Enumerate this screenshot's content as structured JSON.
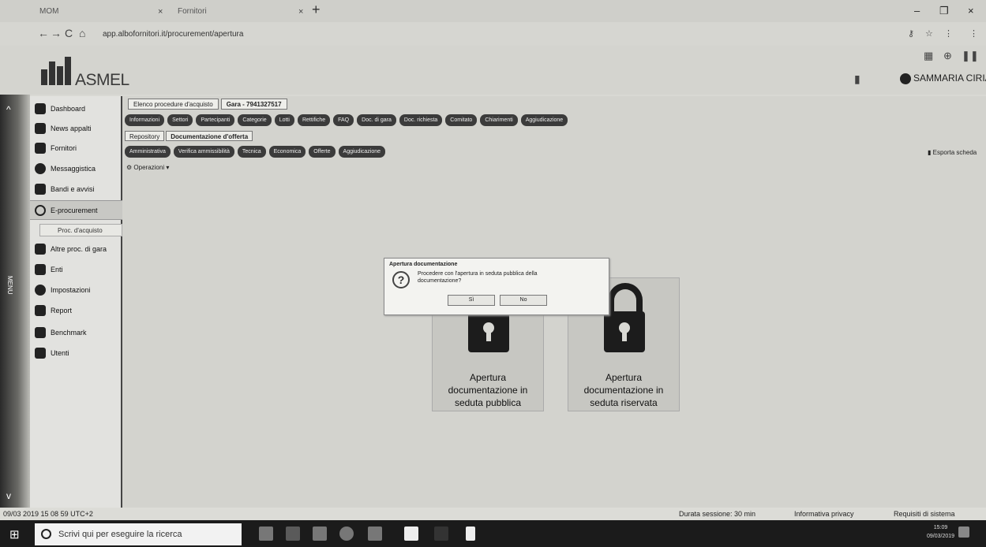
{
  "browser": {
    "tab1_label": "MOM",
    "tab2_label": "Fornitori",
    "url": "app.albofornitori.it/procurement/apertura",
    "close_glyph": "×",
    "new_tab_glyph": "+",
    "minimize_glyph": "–",
    "maximize_glyph": "❐",
    "window_close_glyph": "×",
    "back_glyph": "←",
    "forward_glyph": "→",
    "reload_glyph": "C",
    "home_glyph": "⌂"
  },
  "header": {
    "logo_text": "ASMEL",
    "user_name": "SAMMARIA CIRIANO"
  },
  "sidebar": {
    "items": [
      {
        "label": "Dashboard",
        "icon": "home-icon"
      },
      {
        "label": "News appalti",
        "icon": "news-icon"
      },
      {
        "label": "Fornitori",
        "icon": "truck-icon"
      },
      {
        "label": "Messaggistica",
        "icon": "message-icon"
      },
      {
        "label": "Bandi e avvisi",
        "icon": "megaphone-icon"
      },
      {
        "label": "E-procurement",
        "icon": "procurement-icon"
      },
      {
        "label": "Altre proc. di gara",
        "icon": "folder-icon"
      },
      {
        "label": "Enti",
        "icon": "users-icon"
      },
      {
        "label": "Impostazioni",
        "icon": "gear-icon"
      },
      {
        "label": "Report",
        "icon": "report-icon"
      },
      {
        "label": "Benchmark",
        "icon": "benchmark-icon"
      },
      {
        "label": "Utenti",
        "icon": "user-icon"
      }
    ],
    "submenu_label": "Proc. d'acquisto",
    "side_label": "MENU"
  },
  "main": {
    "breadcrumbs": [
      "Elenco procedure d'acquisto",
      "Gara - 7941327517"
    ],
    "chips_row1": [
      "Informazioni",
      "Settori",
      "Partecipanti",
      "Categorie",
      "Lotti",
      "Rettifiche",
      "FAQ",
      "Doc. di gara",
      "Doc. richiesta",
      "Comitato",
      "Chiarimenti",
      "Aggiudicazione"
    ],
    "subtabs": [
      "Repository",
      "Documentazione d'offerta"
    ],
    "chips_row2": [
      "Amministrativa",
      "Verifica ammissibilità",
      "Tecnica",
      "Economica",
      "Offerte",
      "Aggiudicazione"
    ],
    "export_label": "Esporta scheda",
    "operations_label": "Operazioni"
  },
  "cards": [
    {
      "line1": "Apertura",
      "line2": "documentazione in",
      "line3": "seduta pubblica"
    },
    {
      "line1": "Apertura",
      "line2": "documentazione in",
      "line3": "seduta riservata"
    }
  ],
  "dialog": {
    "title": "Apertura documentazione",
    "message": "Procedere con l'apertura in seduta pubblica della documentazione?",
    "yes_label": "Sì",
    "no_label": "No"
  },
  "statusbar": {
    "datetime": "09/03 2019 15 08 59 UTC+2",
    "session": "Durata sessione: 30 min",
    "privacy": "Informativa privacy",
    "requirements": "Requisiti di sistema"
  },
  "taskbar": {
    "search_placeholder": "Scrivi qui per eseguire la ricerca",
    "time": "15:09",
    "date": "09/03/2019"
  }
}
